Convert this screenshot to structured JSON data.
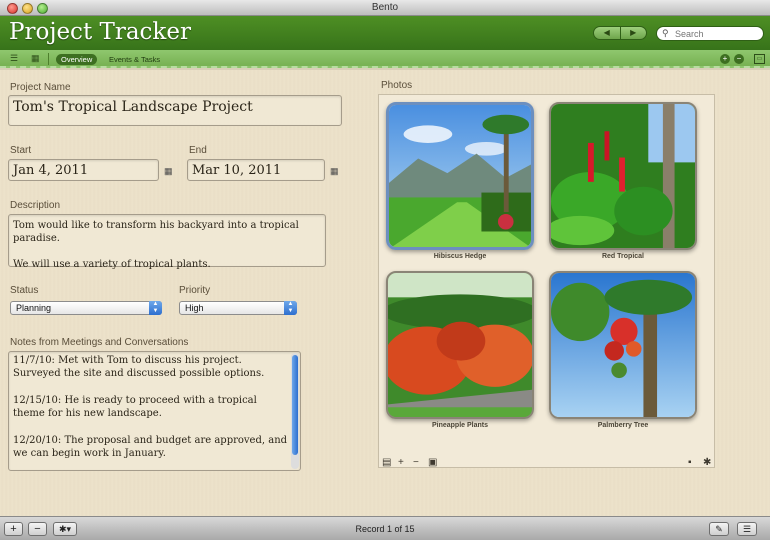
{
  "window": {
    "title": "Bento"
  },
  "header": {
    "app_title": "Project Tracker",
    "nav_back": "◀",
    "nav_forward": "▶",
    "search_placeholder": "Search"
  },
  "subbar": {
    "tabs": [
      {
        "label": "Overview",
        "selected": true
      },
      {
        "label": "Events & Tasks",
        "selected": false
      }
    ]
  },
  "form": {
    "project_name_label": "Project Name",
    "project_name": "Tom's Tropical Landscape Project",
    "start_label": "Start",
    "start_date": "Jan 4, 2011",
    "end_label": "End",
    "end_date": "Mar 10, 2011",
    "description_label": "Description",
    "description": "Tom would like to transform his backyard into a tropical paradise.\n\nWe will use a variety of tropical plants.",
    "status_label": "Status",
    "status_value": "Planning",
    "priority_label": "Priority",
    "priority_value": "High",
    "notes_label": "Notes from Meetings and Conversations",
    "notes": "11/7/10: Met with Tom to discuss his project.  Surveyed the site and discussed possible options.\n\n12/15/10: He is ready to proceed with a tropical theme for his new landscape.\n\n12/20/10: The proposal and budget are approved, and we can begin work in January."
  },
  "photos": {
    "label": "Photos",
    "items": [
      {
        "caption": "Hibiscus Hedge",
        "selected": true
      },
      {
        "caption": "Red Tropical",
        "selected": false
      },
      {
        "caption": "Pineapple Plants",
        "selected": false
      },
      {
        "caption": "Palmberry Tree",
        "selected": false
      }
    ]
  },
  "footer": {
    "record_text": "Record 1 of 15"
  },
  "colors": {
    "header_green": "#3f7f1e",
    "subbar_green": "#80b85c",
    "paper": "#ede3cc",
    "accent_blue": "#2d6fcf"
  }
}
